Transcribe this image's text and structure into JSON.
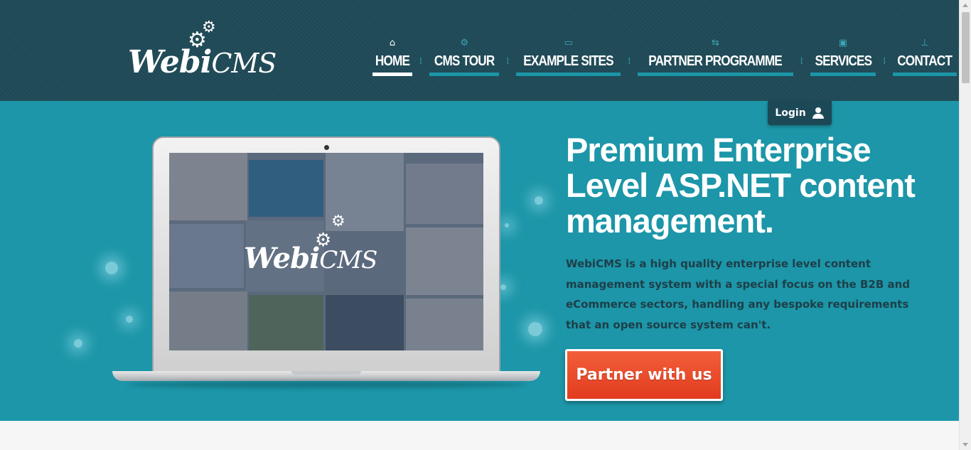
{
  "brand": {
    "logo_main": "Webi",
    "logo_accent": "CMS"
  },
  "nav": {
    "items": [
      {
        "label": "HOME",
        "icon": "home-icon",
        "active": true
      },
      {
        "label": "CMS TOUR",
        "icon": "gear-icon",
        "active": false
      },
      {
        "label": "EXAMPLE SITES",
        "icon": "monitor-icon",
        "active": false
      },
      {
        "label": "PARTNER PROGRAMME",
        "icon": "handshake-icon",
        "active": false
      },
      {
        "label": "SERVICES",
        "icon": "box-icon",
        "active": false
      },
      {
        "label": "CONTACT",
        "icon": "pin-icon",
        "active": false
      }
    ]
  },
  "login": {
    "label": "Login"
  },
  "hero": {
    "headline": "Premium Enterprise Level ASP.NET content management.",
    "intro": "WebiCMS is a high quality enterprise level content management system with a special focus on the B2B and eCommerce sectors, handling any bespoke requirements that an open source system can't.",
    "cta_label": "Partner with us"
  },
  "colors": {
    "header_bg": "#1f4a57",
    "hero_bg": "#1c96a8",
    "accent_bar": "#1b96a8",
    "cta": "#e8482a"
  }
}
